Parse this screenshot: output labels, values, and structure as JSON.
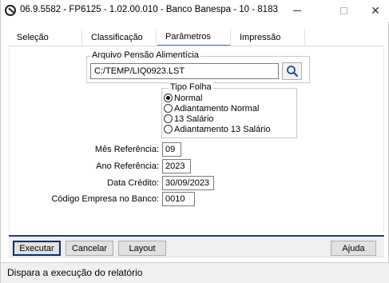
{
  "window": {
    "title": "06.9.5582 - FP6125 - 1.02.00.010 - Banco Banespa - 10 - 8183"
  },
  "tabs": [
    {
      "label": "Seleção"
    },
    {
      "label": "Classificação"
    },
    {
      "label": "Parâmetros"
    },
    {
      "label": "Impressão"
    }
  ],
  "active_tab": "Parâmetros",
  "parametros": {
    "arquivo_group_title": "Arquivo Pensão Alimentícia",
    "arquivo_value": "C:/TEMP/LIQ0923.LST",
    "tipo_folha_title": "Tipo Folha",
    "tipo_folha_options": [
      {
        "label": "Normal",
        "checked": true
      },
      {
        "label": "Adiantamento Normal",
        "checked": false
      },
      {
        "label": "13 Salário",
        "checked": false
      },
      {
        "label": "Adiantamento 13 Salário",
        "checked": false
      }
    ],
    "mes_referencia_label": "Mês Referência:",
    "mes_referencia_value": "09",
    "ano_referencia_label": "Ano Referência:",
    "ano_referencia_value": "2023",
    "data_credito_label": "Data Crédito:",
    "data_credito_value": "30/09/2023",
    "codigo_empresa_label": "Código Empresa no Banco:",
    "codigo_empresa_value": "0010"
  },
  "toolbar": {
    "executar_label": "Executar",
    "cancelar_label": "Cancelar",
    "layout_label": "Layout",
    "ajuda_label": "Ajuda"
  },
  "status": {
    "text": "Dispara a execução do relatório"
  },
  "colors": {
    "toolbar_border": "#1e3f7a",
    "active_tab_underline": "#3a6fd8"
  }
}
